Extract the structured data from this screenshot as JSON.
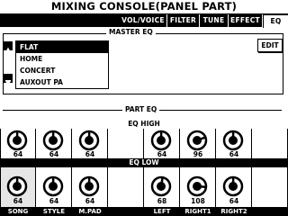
{
  "title": "MIXING CONSOLE(PANEL PART)",
  "tabs": [
    {
      "label": "VOL/VOICE",
      "active": false
    },
    {
      "label": "FILTER",
      "active": false
    },
    {
      "label": "TUNE",
      "active": false
    },
    {
      "label": "EFFECT",
      "active": false
    },
    {
      "label": "EQ",
      "active": true
    }
  ],
  "master_eq": {
    "label": "MASTER EQ",
    "items": [
      "FLAT",
      "HOME",
      "CONCERT",
      "AUXOUT PA"
    ],
    "selected": "FLAT",
    "edit_label": "EDIT",
    "up_icon": "triangle-up-icon",
    "down_icon": "triangle-down-icon"
  },
  "part_eq": {
    "label": "PART EQ",
    "eq_high_label": "EQ HIGH",
    "eq_low_label": "EQ LOW",
    "parts": [
      {
        "name": "SONG",
        "high": "64",
        "low": "64",
        "high_level": 64,
        "low_level": 64
      },
      {
        "name": "STYLE",
        "high": "64",
        "low": "64",
        "high_level": 64,
        "low_level": 64
      },
      {
        "name": "M.PAD",
        "high": "64",
        "low": "64",
        "high_level": 64,
        "low_level": 64
      },
      {
        "name": "",
        "high": "",
        "low": "",
        "high_level": null,
        "low_level": null
      },
      {
        "name": "LEFT",
        "high": "64",
        "low": "68",
        "high_level": 64,
        "low_level": 68
      },
      {
        "name": "RIGHT1",
        "high": "96",
        "low": "108",
        "high_level": 96,
        "low_level": 108
      },
      {
        "name": "RIGHT2",
        "high": "64",
        "low": "64",
        "high_level": 64,
        "low_level": 64
      },
      {
        "name": "",
        "high": "",
        "low": "",
        "high_level": null,
        "low_level": null
      }
    ]
  }
}
